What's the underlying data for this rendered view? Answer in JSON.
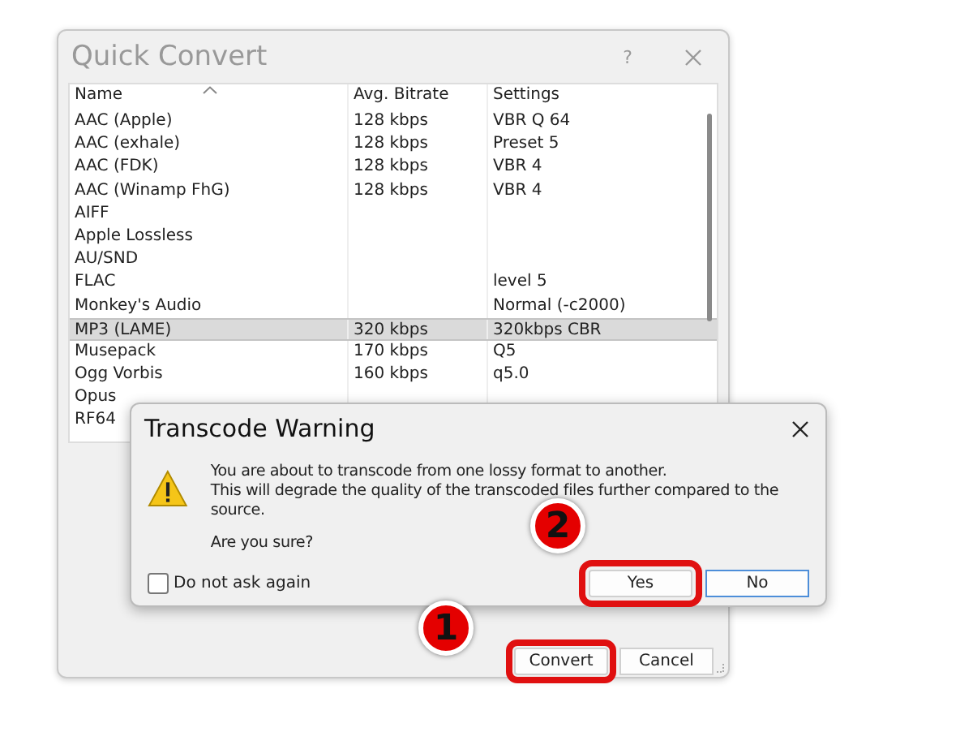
{
  "window": {
    "title": "Quick Convert",
    "help": "?"
  },
  "table": {
    "columns": [
      "Name",
      "Avg. Bitrate",
      "Settings"
    ],
    "rows": [
      {
        "name": "AAC (Apple)",
        "bitrate": "128 kbps",
        "settings": "VBR Q 64",
        "selected": false
      },
      {
        "name": "AAC (exhale)",
        "bitrate": "128 kbps",
        "settings": "Preset 5",
        "selected": false
      },
      {
        "name": "AAC (FDK)",
        "bitrate": "128 kbps",
        "settings": "VBR 4",
        "selected": false
      },
      {
        "name": "AAC (Winamp FhG)",
        "bitrate": "128 kbps",
        "settings": "VBR 4",
        "selected": false
      },
      {
        "name": "AIFF",
        "selected": false
      },
      {
        "name": "Apple Lossless",
        "selected": false
      },
      {
        "name": "AU/SND",
        "selected": false
      },
      {
        "name": "FLAC",
        "settings": "level 5",
        "selected": false
      },
      {
        "name": "Monkey's Audio",
        "settings": "Normal (-c2000)",
        "selected": false
      },
      {
        "name": "MP3 (LAME)",
        "bitrate": "320 kbps",
        "settings": "320kbps CBR",
        "selected": true
      },
      {
        "name": "Musepack",
        "bitrate": "170 kbps",
        "settings": "Q5",
        "selected": false
      },
      {
        "name": "Ogg Vorbis",
        "bitrate": "160 kbps",
        "settings": "q5.0",
        "selected": false
      },
      {
        "name": "Opus",
        "selected": false
      },
      {
        "name": "RF64",
        "selected": false
      }
    ]
  },
  "buttons": [
    {
      "label": "Convert",
      "highlighted": true
    },
    {
      "label": "Cancel",
      "highlighted": false
    }
  ],
  "dialog": {
    "title": "Transcode Warning",
    "message": [
      "You are about to transcode from one lossy format to another.",
      "This will degrade the quality of the transcoded files further compared to the source."
    ],
    "question": "Are you sure?",
    "checkbox": {
      "label": "Do not ask again",
      "checked": false
    },
    "buttons": [
      {
        "label": "Yes",
        "highlighted": true
      },
      {
        "label": "No",
        "highlighted": false
      }
    ]
  },
  "annotations": [
    {
      "number": "1"
    },
    {
      "number": "2"
    }
  ]
}
